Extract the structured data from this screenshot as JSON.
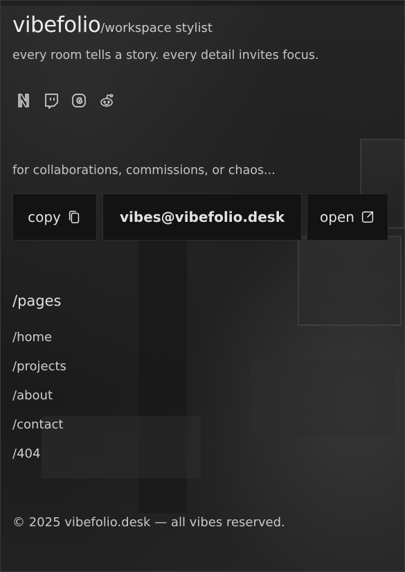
{
  "header": {
    "brand": "vibefolio",
    "role": "/workspace stylist"
  },
  "tagline": "every room tells a story. every detail invites focus.",
  "socials": [
    {
      "icon": "notion-icon"
    },
    {
      "icon": "twitch-icon"
    },
    {
      "icon": "threads-icon"
    },
    {
      "icon": "reddit-icon"
    }
  ],
  "contact": {
    "prompt": "for collaborations, commissions, or chaos...",
    "copy_label": "copy",
    "email": "vibes@vibefolio.desk",
    "open_label": "open"
  },
  "pages": {
    "title": "/pages",
    "links": [
      "/home",
      "/projects",
      "/about",
      "/contact",
      "/404"
    ]
  },
  "footer": "© 2025 vibefolio.desk — all vibes reserved.",
  "colors": {
    "background": "#1c1c1c",
    "button_bg": "#131313",
    "text": "#d6d6d6"
  }
}
